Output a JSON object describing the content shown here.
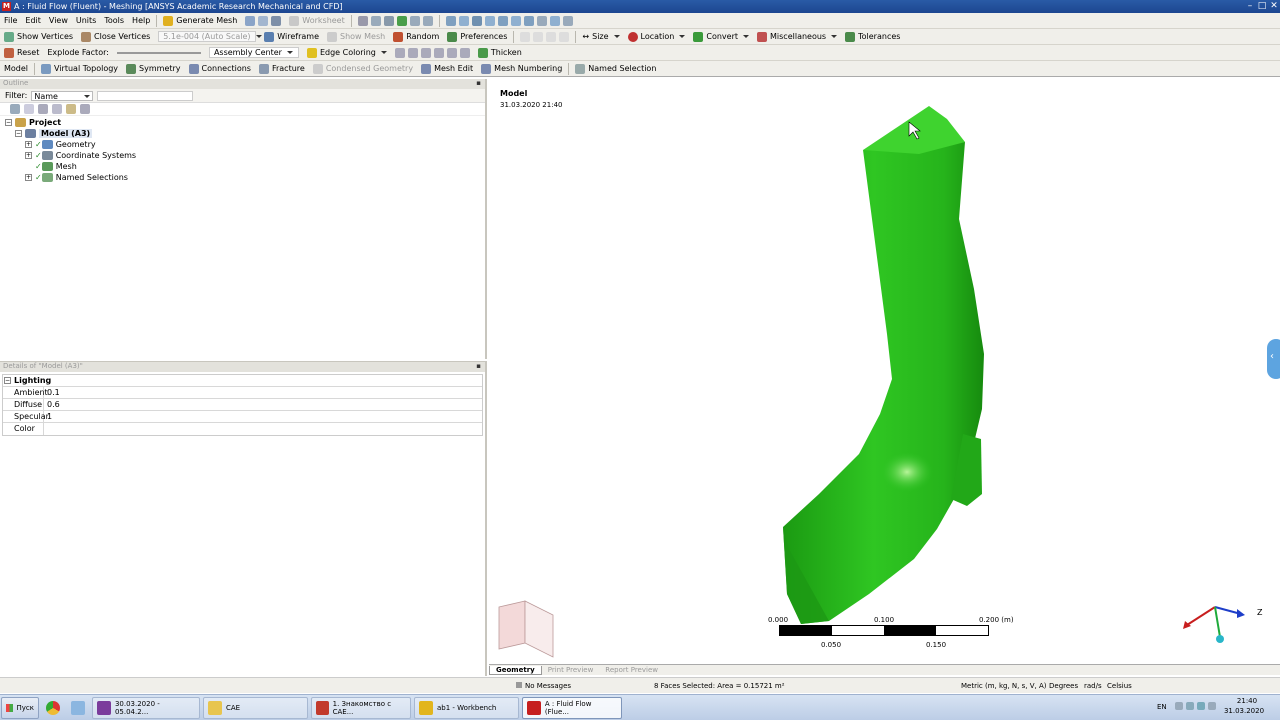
{
  "title": "A : Fluid Flow (Fluent) - Meshing [ANSYS Academic Research Mechanical and CFD]",
  "menu": [
    "File",
    "Edit",
    "View",
    "Units",
    "Tools",
    "Help"
  ],
  "toolbar1": {
    "generate": "Generate Mesh",
    "worksheet": "Worksheet"
  },
  "toolbar2": {
    "show_vertices": "Show Vertices",
    "close_vertices": "Close Vertices",
    "auto_scale": "5.1e-004 (Auto Scale)",
    "wireframe": "Wireframe",
    "show_mesh": "Show Mesh",
    "random": "Random",
    "preferences": "Preferences",
    "size": "Size",
    "location": "Location",
    "convert": "Convert",
    "misc": "Miscellaneous",
    "tolerances": "Tolerances"
  },
  "toolbar3": {
    "reset": "Reset",
    "explode": "Explode Factor:",
    "assembly": "Assembly Center",
    "edge": "Edge Coloring",
    "thicken": "Thicken"
  },
  "toolbar4": [
    "Model",
    "Virtual Topology",
    "Symmetry",
    "Connections",
    "Fracture",
    "Condensed Geometry",
    "Mesh Edit",
    "Mesh Numbering",
    "Named Selection"
  ],
  "outline": {
    "header": "Outline",
    "filter_label": "Filter:",
    "filter_value": "Name",
    "project": "Project",
    "model": "Model (A3)",
    "items": [
      "Geometry",
      "Coordinate Systems",
      "Mesh",
      "Named Selections"
    ]
  },
  "details": {
    "header": "Details of \"Model (A3)\"",
    "group": "Lighting",
    "rows": [
      {
        "k": "Ambient",
        "v": "0.1"
      },
      {
        "k": "Diffuse",
        "v": "0.6"
      },
      {
        "k": "Specular",
        "v": "1"
      },
      {
        "k": "Color",
        "v": ""
      }
    ]
  },
  "viewport": {
    "label": "Model",
    "date": "31.03.2020 21:40",
    "scale": {
      "t0": "0.000",
      "t1": "0.100",
      "t2": "0.200 (m)",
      "b1": "0.050",
      "b2": "0.150"
    },
    "axis_z": "Z"
  },
  "tabs": [
    "Geometry",
    "Print Preview",
    "Report Preview"
  ],
  "status": {
    "messages": "No Messages",
    "selection": "8 Faces Selected: Area = 0.15721 m²",
    "units": "Metric (m, kg, N, s, V, A)",
    "deg": "Degrees",
    "rad": "rad/s",
    "temp": "Celsius"
  },
  "taskbar": {
    "start": "Пуск",
    "items": [
      "30.03.2020 - 05.04.2...",
      "CAE",
      "1. Знакомство с САЕ...",
      "ab1 - Workbench",
      "A : Fluid Flow (Flue..."
    ],
    "lang": "EN",
    "time": "21:40",
    "date": "31.03.2020"
  }
}
